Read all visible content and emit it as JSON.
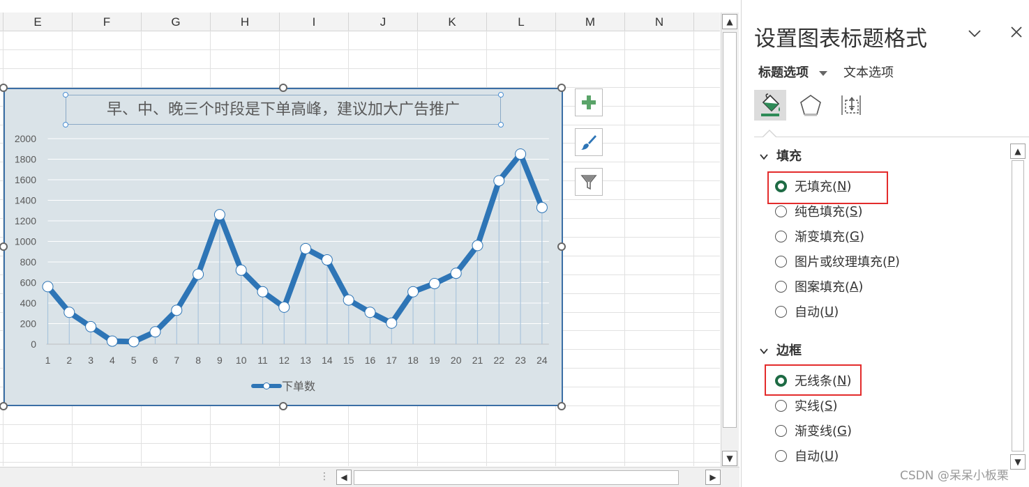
{
  "columns": [
    "E",
    "F",
    "G",
    "H",
    "I",
    "J",
    "K",
    "L",
    "M",
    "N"
  ],
  "chart_data": {
    "type": "line",
    "title": "早、中、晚三个时段是下单高峰，建议加大广告推广",
    "categories": [
      "1",
      "2",
      "3",
      "4",
      "5",
      "6",
      "7",
      "8",
      "9",
      "10",
      "11",
      "12",
      "13",
      "14",
      "15",
      "16",
      "17",
      "18",
      "19",
      "20",
      "21",
      "22",
      "23",
      "24"
    ],
    "series": [
      {
        "name": "下单数",
        "values": [
          560,
          310,
          170,
          30,
          25,
          120,
          330,
          680,
          1260,
          720,
          510,
          360,
          930,
          820,
          430,
          310,
          205,
          510,
          590,
          690,
          960,
          1590,
          1850,
          1330
        ]
      }
    ],
    "ylim": [
      0,
      2000
    ],
    "yticks": [
      "0",
      "200",
      "400",
      "600",
      "800",
      "1000",
      "1200",
      "1400",
      "1600",
      "1800",
      "2000"
    ],
    "grid": true,
    "legend_position": "bottom",
    "colors": {
      "line": "#2e75b6",
      "drop_line": "#a9c4dc",
      "plot_bg": "#dae3e8"
    }
  },
  "chart_buttons": {
    "add": "chart-elements",
    "style": "chart-styles",
    "filter": "chart-filters"
  },
  "panel": {
    "title": "设置图表标题格式",
    "tabs": {
      "title_options": "标题选项",
      "text_options": "文本选项"
    },
    "fill": {
      "heading": "填充",
      "options": [
        {
          "label": "无填充(",
          "key": "N",
          "selected": true
        },
        {
          "label": "纯色填充(",
          "key": "S",
          "selected": false
        },
        {
          "label": "渐变填充(",
          "key": "G",
          "selected": false
        },
        {
          "label": "图片或纹理填充(",
          "key": "P",
          "selected": false
        },
        {
          "label": "图案填充(",
          "key": "A",
          "selected": false
        },
        {
          "label": "自动(",
          "key": "U",
          "selected": false
        }
      ]
    },
    "border": {
      "heading": "边框",
      "options": [
        {
          "label": "无线条(",
          "key": "N",
          "selected": true
        },
        {
          "label": "实线(",
          "key": "S",
          "selected": false
        },
        {
          "label": "渐变线(",
          "key": "G",
          "selected": false
        },
        {
          "label": "自动(",
          "key": "U",
          "selected": false
        }
      ]
    }
  },
  "watermark": "CSDN @呆呆小板栗"
}
